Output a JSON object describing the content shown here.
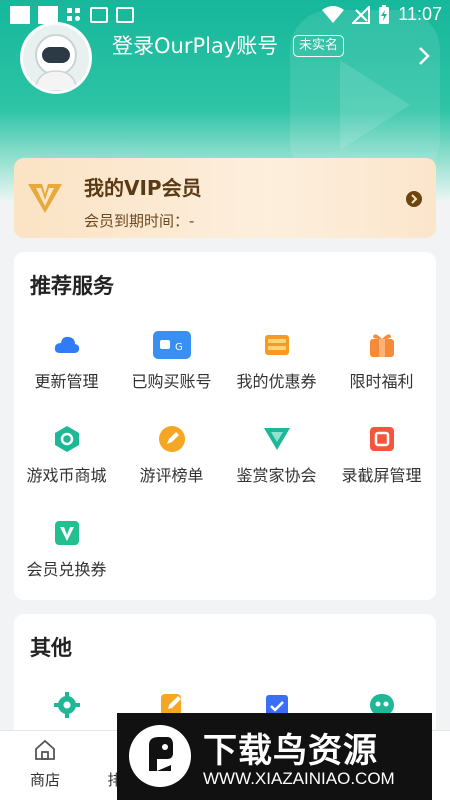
{
  "status_bar": {
    "time": "11:07"
  },
  "profile": {
    "title": "登录OurPlay账号",
    "badge": "未实名"
  },
  "vip": {
    "title": "我的VIP会员",
    "expire": "会员到期时间：-"
  },
  "services": {
    "title": "推荐服务",
    "items": [
      {
        "label": "更新管理",
        "icon": "cloud-icon",
        "color": "#2e7cf6"
      },
      {
        "label": "已购买账号",
        "icon": "account-card-icon",
        "color": "#3a8ff5"
      },
      {
        "label": "我的优惠券",
        "icon": "coupon-icon",
        "color": "#f59b1f"
      },
      {
        "label": "限时福利",
        "icon": "gift-icon",
        "color": "#f58a3a"
      },
      {
        "label": "游戏币商城",
        "icon": "coin-hexagon-icon",
        "color": "#1eb896"
      },
      {
        "label": "游评榜单",
        "icon": "review-pen-icon",
        "color": "#f5a623"
      },
      {
        "label": "鉴赏家协会",
        "icon": "connoisseur-icon",
        "color": "#1eb896"
      },
      {
        "label": "录截屏管理",
        "icon": "screen-record-icon",
        "color": "#f5553a"
      },
      {
        "label": "会员兑换券",
        "icon": "vip-voucher-icon",
        "color": "#22c08f"
      }
    ]
  },
  "other": {
    "title": "其他",
    "items": [
      {
        "icon": "settings-gear-icon",
        "color": "#1eb896"
      },
      {
        "icon": "feedback-edit-icon",
        "color": "#f5a623"
      },
      {
        "icon": "calendar-check-icon",
        "color": "#3a6ff5"
      },
      {
        "icon": "robot-service-icon",
        "color": "#1eb896"
      }
    ]
  },
  "tabbar": {
    "items": [
      {
        "label": "商店"
      },
      {
        "label": "排行榜"
      }
    ]
  },
  "watermark": {
    "title": "下载鸟资源",
    "url": "WWW.XIAZAINIAO.COM"
  },
  "colors": {
    "brand": "#16b79b",
    "vip_bg": "#fbe3c4",
    "page_bg": "#f2f3f5"
  }
}
